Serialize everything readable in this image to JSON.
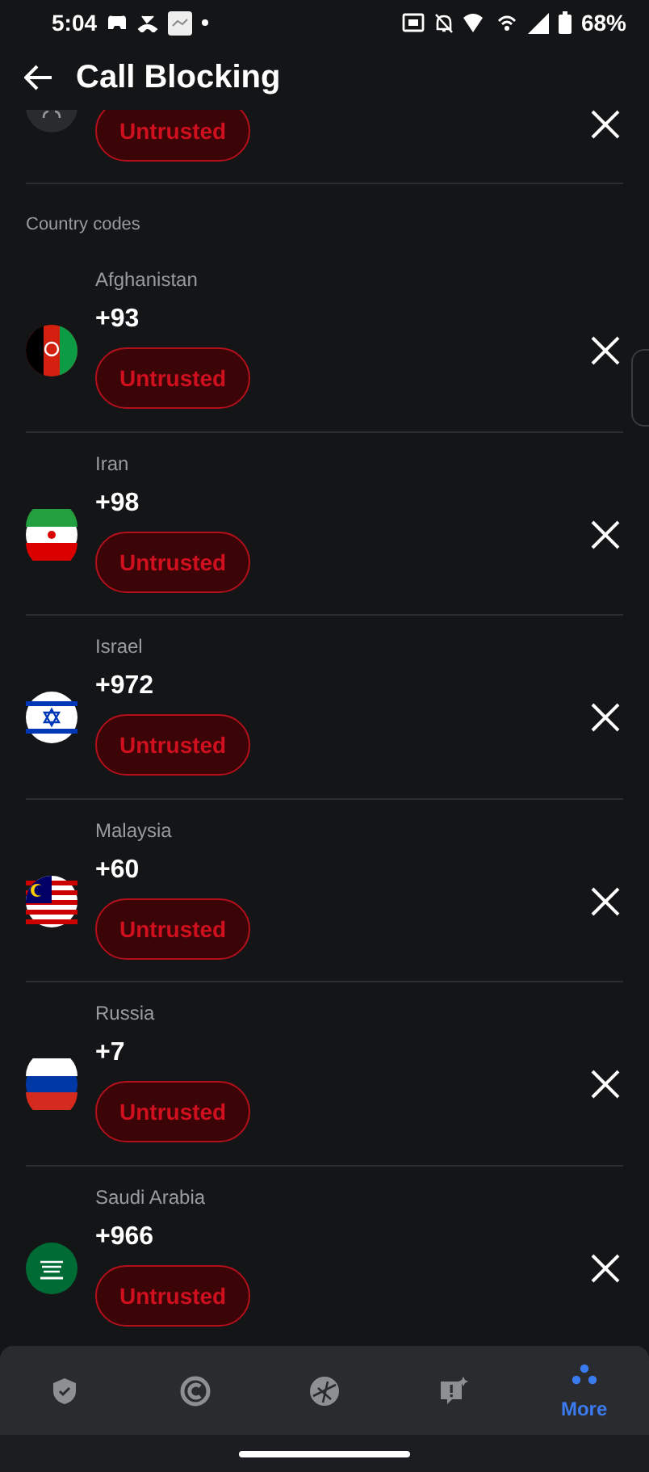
{
  "status_bar": {
    "time": "5:04",
    "battery": "68%"
  },
  "header": {
    "title": "Call Blocking"
  },
  "partial_entry": {
    "tag": "Untrusted"
  },
  "section": {
    "title": "Country codes"
  },
  "entries": [
    {
      "country": "Afghanistan",
      "code": "+93",
      "tag": "Untrusted"
    },
    {
      "country": "Iran",
      "code": "+98",
      "tag": "Untrusted"
    },
    {
      "country": "Israel",
      "code": "+972",
      "tag": "Untrusted"
    },
    {
      "country": "Malaysia",
      "code": "+60",
      "tag": "Untrusted"
    },
    {
      "country": "Russia",
      "code": "+7",
      "tag": "Untrusted"
    },
    {
      "country": "Saudi Arabia",
      "code": "+966",
      "tag": "Untrusted"
    }
  ],
  "bottom_nav": [
    {
      "selected": false
    },
    {
      "selected": false
    },
    {
      "selected": false
    },
    {
      "selected": false
    },
    {
      "label": "More",
      "selected": true
    }
  ]
}
